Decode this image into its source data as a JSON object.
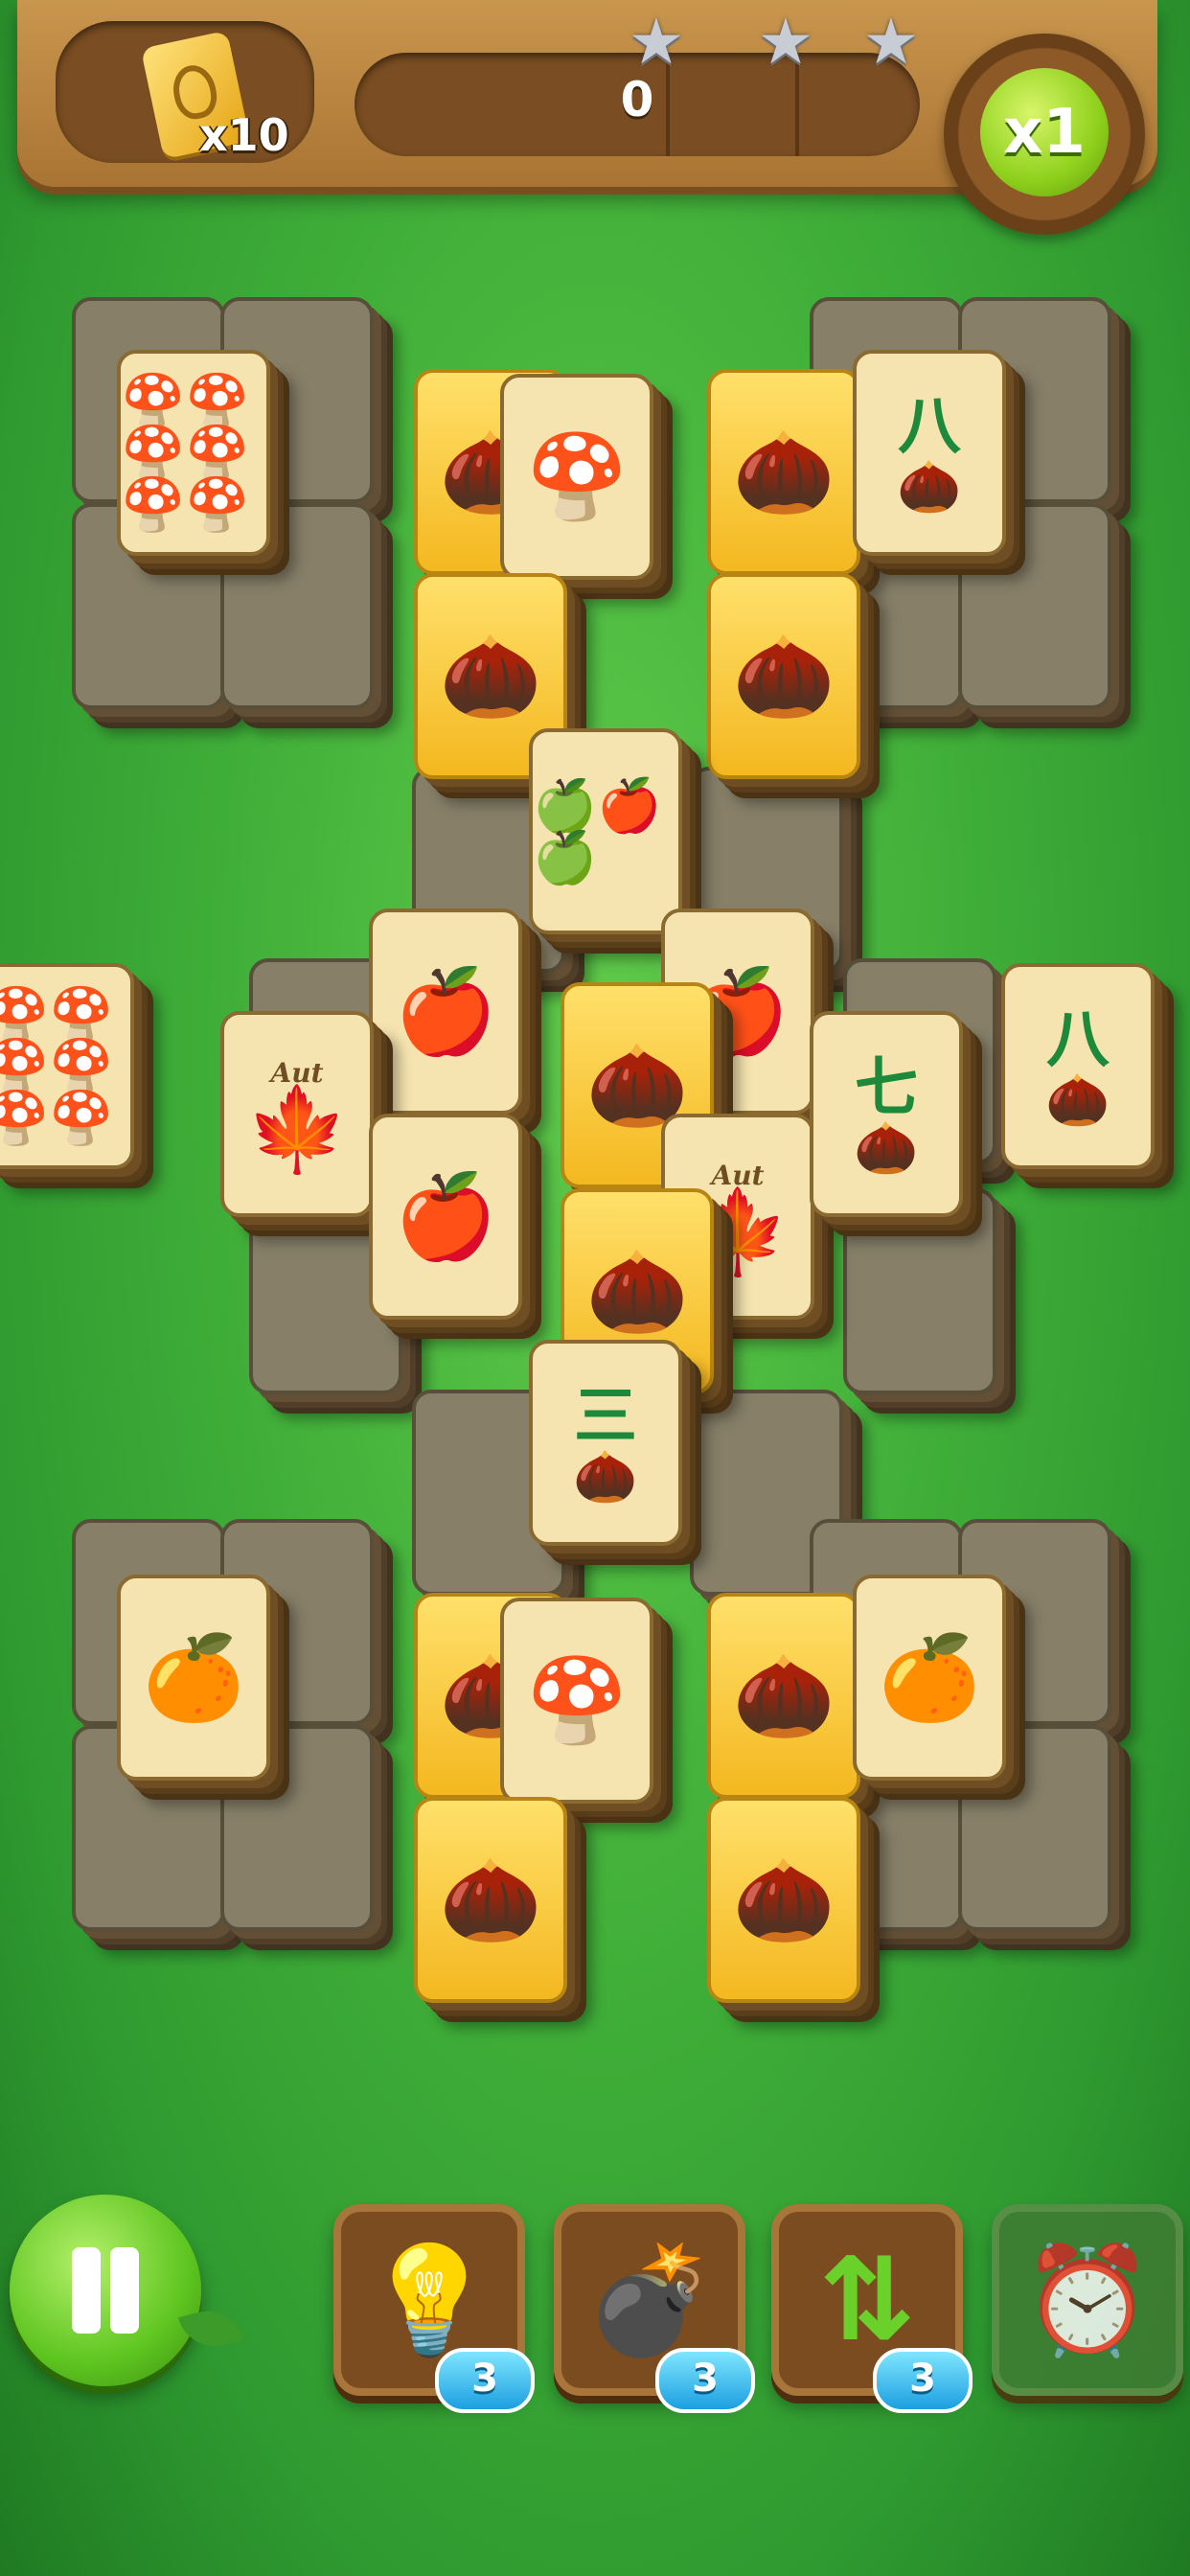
{
  "header": {
    "coin_count": "x10",
    "score": "0",
    "stars_earned": 0,
    "stars_total": 3,
    "multiplier": "x1"
  },
  "board": {
    "tiles": [
      {
        "id": "t1",
        "symbol": "mushroom-6-icon",
        "label": "🍄🍄🍄🍄🍄🍄",
        "kind": "normal"
      },
      {
        "id": "t2",
        "symbol": "acorn-icon",
        "label": "🌰",
        "kind": "gold"
      },
      {
        "id": "t3",
        "symbol": "mushroom-2-icon",
        "label": "🍄",
        "kind": "normal"
      },
      {
        "id": "t4",
        "symbol": "acorn-icon",
        "label": "🌰",
        "kind": "gold"
      },
      {
        "id": "t5",
        "symbol": "pinecone-8-icon",
        "num": "八",
        "label": "🌰",
        "kind": "normal"
      },
      {
        "id": "t6",
        "symbol": "acorn-icon",
        "label": "🌰",
        "kind": "gold"
      },
      {
        "id": "t7",
        "symbol": "acorn-icon",
        "label": "🌰",
        "kind": "gold"
      },
      {
        "id": "t8",
        "symbol": "apple-3-icon",
        "label": "🍏🍎🍏",
        "kind": "normal"
      },
      {
        "id": "t9",
        "symbol": "mushroom-6-icon",
        "label": "🍄🍄🍄🍄🍄🍄",
        "kind": "normal"
      },
      {
        "id": "t10",
        "symbol": "apple-icon",
        "label": "🍎",
        "kind": "normal"
      },
      {
        "id": "t11",
        "symbol": "apple-icon",
        "label": "🍎",
        "kind": "normal"
      },
      {
        "id": "t12",
        "symbol": "maple-leaf-icon",
        "aut": "Aut",
        "label": "🍁",
        "kind": "normal"
      },
      {
        "id": "t13",
        "symbol": "acorn-icon",
        "label": "🌰",
        "kind": "gold"
      },
      {
        "id": "t14",
        "symbol": "apple-icon",
        "label": "🍎",
        "kind": "normal"
      },
      {
        "id": "t15",
        "symbol": "maple-leaf-icon",
        "aut": "Aut",
        "label": "🍁",
        "kind": "normal"
      },
      {
        "id": "t16",
        "symbol": "pinecone-7-icon",
        "num": "七",
        "label": "🌰",
        "kind": "normal"
      },
      {
        "id": "t17",
        "symbol": "pinecone-8-icon",
        "num": "八",
        "label": "🌰",
        "kind": "normal"
      },
      {
        "id": "t18",
        "symbol": "acorn-icon",
        "label": "🌰",
        "kind": "gold"
      },
      {
        "id": "t19",
        "symbol": "pinecone-3-icon",
        "num": "三",
        "label": "🌰",
        "kind": "normal"
      },
      {
        "id": "t20",
        "symbol": "orange-icon",
        "label": "🍊",
        "kind": "normal"
      },
      {
        "id": "t21",
        "symbol": "acorn-icon",
        "label": "🌰",
        "kind": "gold"
      },
      {
        "id": "t22",
        "symbol": "mushroom-2-icon",
        "label": "🍄",
        "kind": "normal"
      },
      {
        "id": "t23",
        "symbol": "acorn-icon",
        "label": "🌰",
        "kind": "gold"
      },
      {
        "id": "t24",
        "symbol": "orange-icon",
        "label": "🍊",
        "kind": "normal"
      },
      {
        "id": "t25",
        "symbol": "acorn-icon",
        "label": "🌰",
        "kind": "gold"
      },
      {
        "id": "t26",
        "symbol": "acorn-icon",
        "label": "🌰",
        "kind": "gold"
      }
    ]
  },
  "toolbar": {
    "hint": {
      "icon": "lightbulb-icon",
      "count": "3"
    },
    "shuffle_bomb": {
      "icon": "bomb-icon",
      "count": "3"
    },
    "undo": {
      "icon": "swap-arrows-icon",
      "count": "3"
    },
    "time": {
      "icon": "alarm-clock-icon",
      "enabled": false
    }
  },
  "colors": {
    "background": "#3fae38",
    "wood": "#a97433",
    "tile_face": "#f6e4b0",
    "gold_tile": "#f4b820",
    "badge": "#1c9fe0"
  }
}
